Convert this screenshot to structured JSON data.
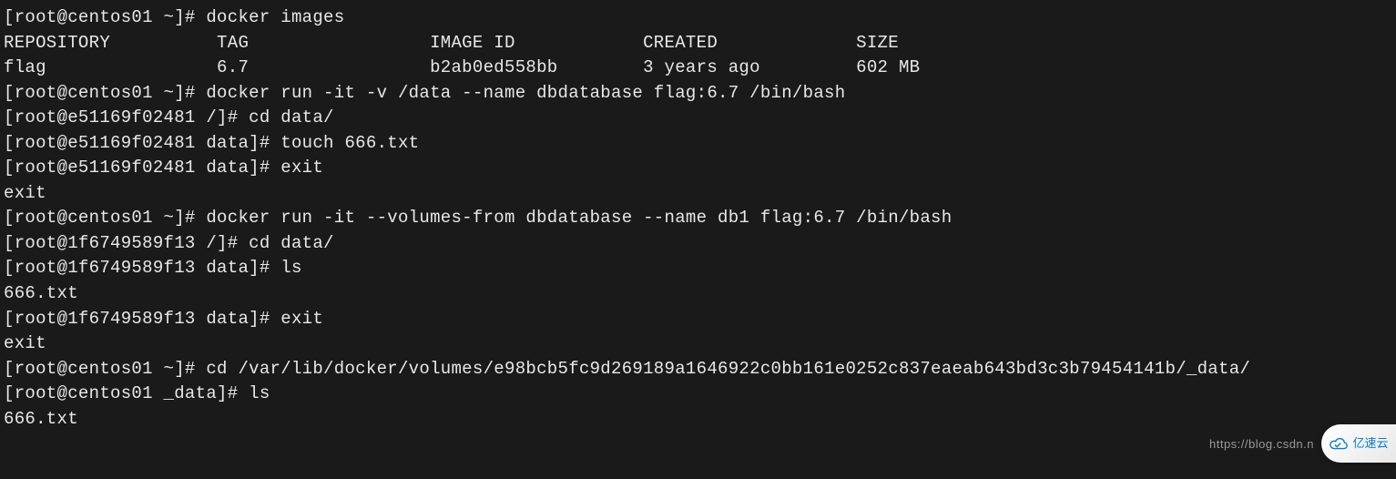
{
  "lines": {
    "l00": "[root@centos01 ~]# docker images",
    "l01": "REPOSITORY          TAG                 IMAGE ID            CREATED             SIZE",
    "l02": "flag                6.7                 b2ab0ed558bb        3 years ago         602 MB",
    "l03": "[root@centos01 ~]# docker run -it -v /data --name dbdatabase flag:6.7 /bin/bash",
    "l04": "[root@e51169f02481 /]# cd data/",
    "l05": "[root@e51169f02481 data]# touch 666.txt",
    "l06": "[root@e51169f02481 data]# exit",
    "l07": "exit",
    "l08": "[root@centos01 ~]# docker run -it --volumes-from dbdatabase --name db1 flag:6.7 /bin/bash",
    "l09": "[root@1f6749589f13 /]# cd data/",
    "l10": "[root@1f6749589f13 data]# ls",
    "l11": "666.txt",
    "l12": "[root@1f6749589f13 data]# exit",
    "l13": "exit",
    "l14": "[root@centos01 ~]# cd /var/lib/docker/volumes/e98bcb5fc9d269189a1646922c0bb161e0252c837eaeab643bd3c3b79454141b/_data/",
    "l15": "[root@centos01 _data]# ls",
    "l16": "666.txt"
  },
  "watermark": "https://blog.csdn.n",
  "logo_text": "亿速云"
}
